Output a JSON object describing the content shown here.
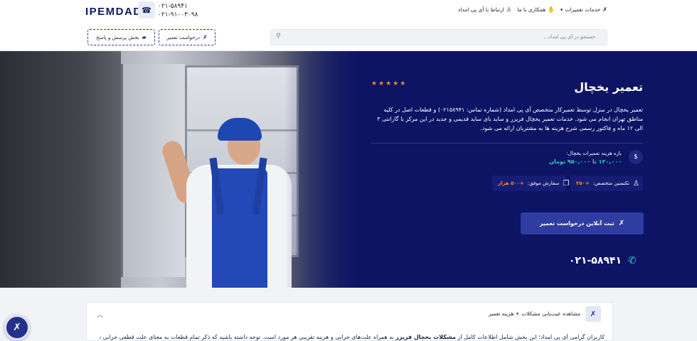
{
  "header": {
    "logo": "IPEMDAD",
    "phones": [
      "۰۲۱-۵۸۹۴۱",
      "۰۲۱-۹۱۰۰۳۰۹۸"
    ],
    "nav": [
      {
        "label": "خدمات تعمیرات",
        "icon": "tools-icon"
      },
      {
        "label": "همکاری با ما",
        "icon": "handshake-icon"
      },
      {
        "label": "ارتباط با آی پی امداد",
        "icon": "support-icon"
      }
    ],
    "search_placeholder": "جستجو در آی پی امداد...",
    "repair_request_label": "درخواست تعمیر",
    "qa_label": "بخش پرسش و پاسخ"
  },
  "hero": {
    "rating_stars": 5,
    "stars": "★★★★★",
    "title": "تعمیر یخچال",
    "description": "تعمیر یخچال در منزل توسط تعمیرکار متخصص آی پی امداد (شماره تماس: ۰۲۱۵۸۹۴۱) و قطعات اصل در کلیه مناطق تهران انجام می شود. خدمات تعمیر یخچال فریزر و ساید بای ساید قدیمی و جدید در این مرکز با گارانتی ۳ الی ۱۲ ماه و فاکتور رسمی شرح هزینه ها به مشتریان ارائه می شود.",
    "price_label": "بازه هزینه تعمیرات یخچال:",
    "price_value": "۱۲۰,۰۰۰ تا ۹۵۰,۰۰۰ تومان",
    "technicians_label": "تکنسین متخصص:",
    "technicians_value": "+۲۵۰",
    "orders_label": "سفارش موفق:",
    "orders_value": "+۵۰۰ هزار",
    "cta_label": "ثبت آنلاین درخواست تعمیر",
    "phone": "۰۲۱-۵۸۹۴۱"
  },
  "accordion": {
    "title": "مشاهده عیب‌یابی مشکلات + هزینه تعمیر",
    "body_prefix": "کاربران گرامی آی پی امداد؛ این بخش شامل اطلاعات کامل از ",
    "body_bold": "مشکلات یخچال فریزر",
    "body_suffix": " به همراه علت‌های خرابی و هزینه تقریبی هر مورد است. توجه داشته باشید که ذکر تمام قطعات به معنای علت قطعی خرابی نیست و"
  },
  "colors": {
    "brand": "#0d1464",
    "accent": "#f58a2a",
    "teal": "#28d3c4",
    "button": "#2f3ca0"
  }
}
